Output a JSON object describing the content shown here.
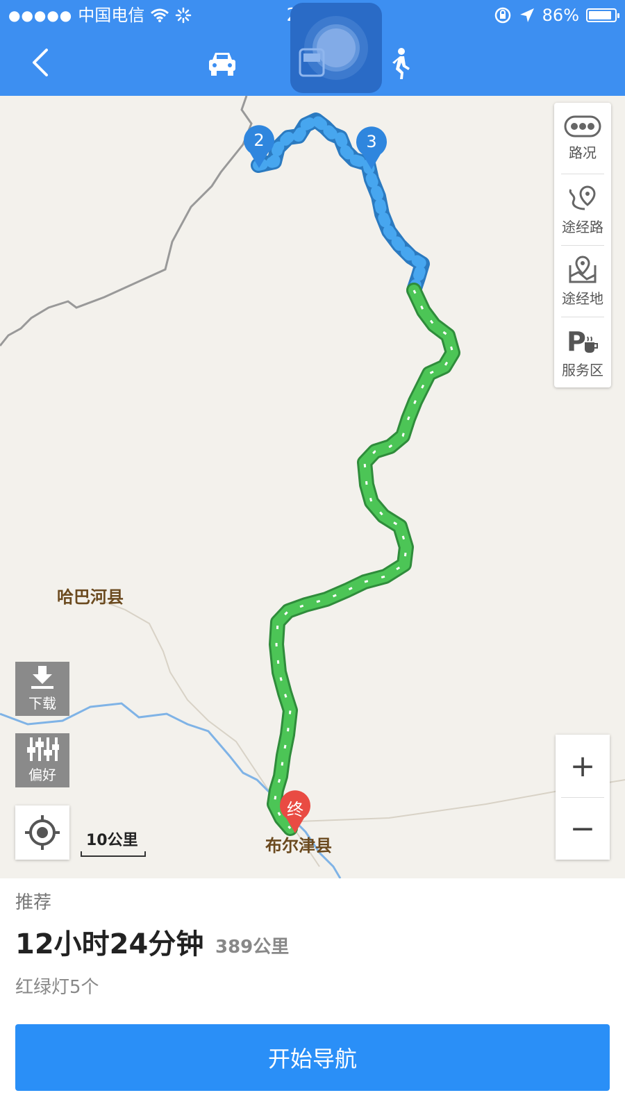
{
  "status_bar": {
    "carrier": "中国电信",
    "time": "22:30",
    "battery": "86%"
  },
  "modes": {
    "selected": "bus"
  },
  "map": {
    "labels": {
      "haba": "哈巴河县",
      "buerjin": "布尔津县"
    },
    "markers": {
      "waypoint_2": "2",
      "waypoint_3": "3",
      "end": "终"
    },
    "side_panel": {
      "traffic": "路况",
      "via_road": "途经路",
      "via_place": "途经地",
      "service_area": "服务区"
    },
    "left_buttons": {
      "download": "下载",
      "preference": "偏好"
    },
    "scale": "10公里",
    "zoom_in": "+",
    "zoom_out": "−"
  },
  "route_info": {
    "recommend_label": "推荐",
    "duration": "12小时24分钟",
    "distance": "389公里",
    "traffic_lights": "红绿灯5个"
  },
  "actions": {
    "start_navigation": "开始导航"
  },
  "colors": {
    "header": "#3d8ff1",
    "route_blue": "#3aa0e8",
    "route_green": "#3ec24a",
    "button": "#2a8ff7"
  }
}
